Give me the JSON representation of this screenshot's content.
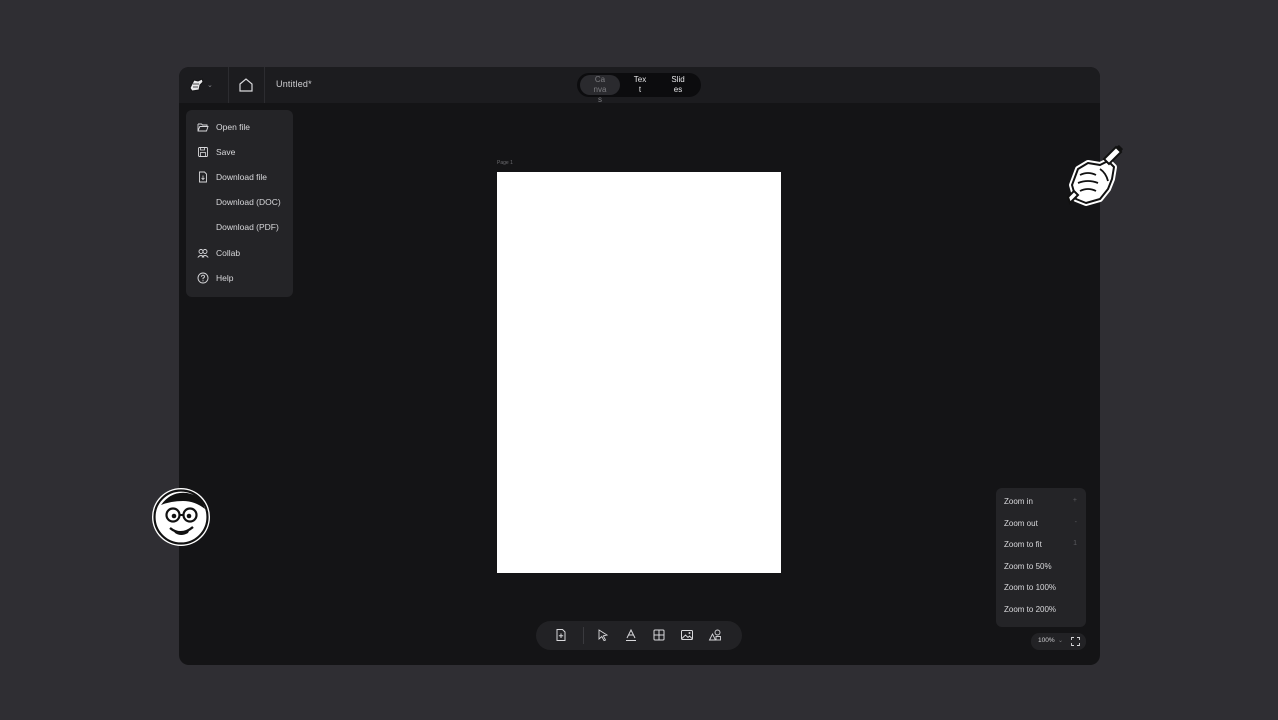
{
  "header": {
    "doc_title": "Untitled*",
    "modes": [
      {
        "label": "Canvas",
        "active": true
      },
      {
        "label": "Text",
        "active": false
      },
      {
        "label": "Slides",
        "active": false
      }
    ]
  },
  "file_menu": {
    "items": [
      {
        "label": "Open file",
        "icon": "folder-open-icon"
      },
      {
        "label": "Save",
        "icon": "save-icon"
      },
      {
        "label": "Download file",
        "icon": "download-file-icon"
      },
      {
        "label": "Download (DOC)",
        "icon": ""
      },
      {
        "label": "Download (PDF)",
        "icon": ""
      },
      {
        "label": "Collab",
        "icon": "users-icon"
      },
      {
        "label": "Help",
        "icon": "help-icon"
      }
    ]
  },
  "canvas": {
    "page_label": "Page 1"
  },
  "toolbar": {
    "tools": [
      "add-page-icon",
      "select-cursor-icon",
      "text-icon",
      "table-icon",
      "image-icon",
      "shapes-icon"
    ]
  },
  "zoom_menu": {
    "items": [
      {
        "label": "Zoom in",
        "shortcut": "+"
      },
      {
        "label": "Zoom out",
        "shortcut": "-"
      },
      {
        "label": "Zoom to fit",
        "shortcut": "1"
      },
      {
        "label": "Zoom to 50%",
        "shortcut": ""
      },
      {
        "label": "Zoom to 100%",
        "shortcut": ""
      },
      {
        "label": "Zoom to 200%",
        "shortcut": ""
      }
    ]
  },
  "zoom": {
    "value": "100%"
  },
  "colors": {
    "background": "#2f2e33",
    "app": "#141416",
    "page": "#ffffff"
  }
}
